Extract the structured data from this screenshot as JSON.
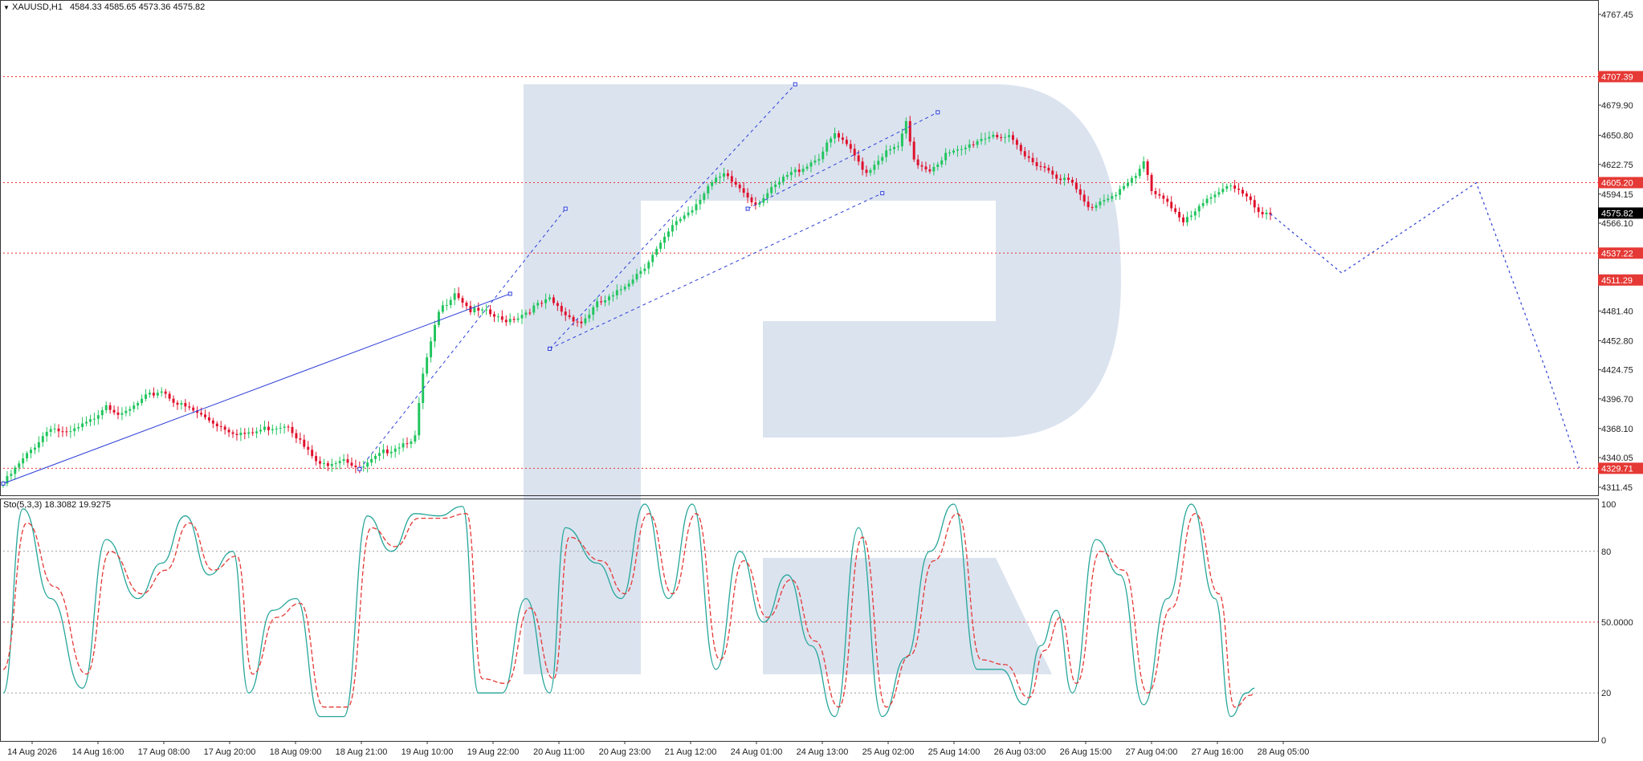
{
  "main_chart": {
    "symbol_header": "XAUUSD,H1",
    "ohlc": "4584.33 4585.65 4573.36 4575.82",
    "chart_data": {
      "type": "candlestick",
      "symbol": "XAUUSD",
      "timeframe": "H1",
      "ylim": [
        4306.0,
        4772.0
      ],
      "y_ticks": [
        "4767.45",
        "4679.90",
        "4650.80",
        "4622.75",
        "4594.15",
        "4566.10",
        "4481.40",
        "4452.80",
        "4424.75",
        "4396.70",
        "4368.10",
        "4340.05",
        "4311.45"
      ],
      "x_ticks": [
        "14 Aug 2026",
        "14 Aug 16:00",
        "17 Aug 08:00",
        "17 Aug 20:00",
        "18 Aug 09:00",
        "18 Aug 21:00",
        "19 Aug 10:00",
        "19 Aug 22:00",
        "20 Aug 11:00",
        "20 Aug 23:00",
        "21 Aug 12:00",
        "24 Aug 01:00",
        "24 Aug 13:00",
        "25 Aug 02:00",
        "25 Aug 14:00",
        "26 Aug 03:00",
        "26 Aug 15:00",
        "27 Aug 04:00",
        "27 Aug 16:00",
        "28 Aug 05:00"
      ],
      "levels": [
        {
          "value": 4707.39,
          "label": "4707.39"
        },
        {
          "value": 4605.2,
          "label": "4605.20"
        },
        {
          "value": 4537.22,
          "label": "4537.22"
        },
        {
          "value": 4329.71,
          "label": "4329.71"
        }
      ],
      "right_tags": [
        {
          "value": 4707.39,
          "label": "4707.39",
          "color": "#e53935"
        },
        {
          "value": 4605.2,
          "label": "4605.20",
          "color": "#e53935"
        },
        {
          "value": 4575.82,
          "label": "4575.82",
          "color": "#000000"
        },
        {
          "value": 4537.22,
          "label": "4537.22",
          "color": "#e53935"
        },
        {
          "value": 4511.29,
          "label": "4511.29",
          "color": "#e53935"
        },
        {
          "value": 4329.71,
          "label": "4329.71",
          "color": "#e53935"
        }
      ],
      "anchors": [
        [
          0,
          4315
        ],
        [
          12,
          4370
        ],
        [
          16,
          4362
        ],
        [
          22,
          4375
        ],
        [
          26,
          4392
        ],
        [
          30,
          4380
        ],
        [
          36,
          4398
        ],
        [
          40,
          4405
        ],
        [
          44,
          4392
        ],
        [
          48,
          4385
        ],
        [
          54,
          4372
        ],
        [
          58,
          4365
        ],
        [
          62,
          4362
        ],
        [
          66,
          4368
        ],
        [
          72,
          4372
        ],
        [
          76,
          4350
        ],
        [
          80,
          4332
        ],
        [
          86,
          4340
        ],
        [
          90,
          4328
        ],
        [
          96,
          4345
        ],
        [
          100,
          4352
        ],
        [
          104,
          4360
        ],
        [
          106,
          4420
        ],
        [
          110,
          4480
        ],
        [
          114,
          4500
        ],
        [
          118,
          4482
        ],
        [
          122,
          4480
        ],
        [
          126,
          4472
        ],
        [
          130,
          4476
        ],
        [
          134,
          4485
        ],
        [
          138,
          4492
        ],
        [
          142,
          4478
        ],
        [
          146,
          4470
        ],
        [
          150,
          4488
        ],
        [
          154,
          4495
        ],
        [
          158,
          4510
        ],
        [
          162,
          4525
        ],
        [
          166,
          4545
        ],
        [
          170,
          4568
        ],
        [
          174,
          4580
        ],
        [
          178,
          4602
        ],
        [
          182,
          4612
        ],
        [
          186,
          4600
        ],
        [
          190,
          4585
        ],
        [
          194,
          4598
        ],
        [
          198,
          4612
        ],
        [
          202,
          4620
        ],
        [
          206,
          4630
        ],
        [
          210,
          4652
        ],
        [
          214,
          4636
        ],
        [
          218,
          4615
        ],
        [
          222,
          4632
        ],
        [
          226,
          4640
        ],
        [
          228,
          4662
        ],
        [
          230,
          4625
        ],
        [
          234,
          4618
        ],
        [
          238,
          4632
        ],
        [
          242,
          4636
        ],
        [
          246,
          4646
        ],
        [
          250,
          4652
        ],
        [
          254,
          4648
        ],
        [
          258,
          4630
        ],
        [
          262,
          4622
        ],
        [
          266,
          4612
        ],
        [
          270,
          4604
        ],
        [
          274,
          4580
        ],
        [
          278,
          4590
        ],
        [
          282,
          4598
        ],
        [
          286,
          4610
        ],
        [
          288,
          4625
        ],
        [
          290,
          4598
        ],
        [
          294,
          4588
        ],
        [
          298,
          4566
        ],
        [
          302,
          4580
        ],
        [
          306,
          4596
        ],
        [
          310,
          4604
        ],
        [
          314,
          4590
        ],
        [
          318,
          4572
        ],
        [
          320,
          4575
        ]
      ],
      "pattern_lines": [
        {
          "points": [
            [
              0,
              4315
            ],
            [
              128,
              4498
            ]
          ],
          "style": "solid"
        },
        [
          [
            90,
            4329
          ],
          [
            142,
            4580
          ]
        ],
        [
          [
            138,
            4445
          ],
          [
            222,
            4595
          ]
        ],
        [
          [
            138,
            4445
          ],
          [
            200,
            4700
          ]
        ],
        [
          [
            188,
            4580
          ],
          [
            236,
            4673
          ]
        ]
      ],
      "forecast": [
        [
          320,
          4575
        ],
        [
          338,
          4518
        ],
        [
          372,
          4605
        ],
        [
          390,
          4420
        ],
        [
          398,
          4330
        ]
      ]
    }
  },
  "indicator": {
    "label": "Sto(5,3,3) 18.3082 19.9275",
    "chart_data": {
      "type": "line",
      "ylim": [
        0,
        100
      ],
      "y_ticks": [
        "100",
        "80",
        "50.0000",
        "20",
        "0"
      ],
      "levels": [
        80,
        50,
        20
      ],
      "series": [
        {
          "name": "Main",
          "color": "#26a69a",
          "style": "solid"
        },
        {
          "name": "Signal",
          "color": "#e53935",
          "style": "dashed"
        }
      ],
      "main_anchors": [
        [
          0,
          20
        ],
        [
          5,
          98
        ],
        [
          12,
          60
        ],
        [
          20,
          22
        ],
        [
          26,
          85
        ],
        [
          34,
          60
        ],
        [
          40,
          75
        ],
        [
          46,
          95
        ],
        [
          52,
          70
        ],
        [
          58,
          80
        ],
        [
          62,
          20
        ],
        [
          68,
          55
        ],
        [
          74,
          60
        ],
        [
          80,
          10
        ],
        [
          86,
          10
        ],
        [
          92,
          95
        ],
        [
          98,
          80
        ],
        [
          104,
          96
        ],
        [
          110,
          95
        ],
        [
          116,
          99
        ],
        [
          120,
          20
        ],
        [
          126,
          20
        ],
        [
          132,
          60
        ],
        [
          138,
          20
        ],
        [
          142,
          90
        ],
        [
          150,
          75
        ],
        [
          156,
          60
        ],
        [
          162,
          100
        ],
        [
          168,
          60
        ],
        [
          174,
          100
        ],
        [
          180,
          30
        ],
        [
          186,
          80
        ],
        [
          192,
          50
        ],
        [
          198,
          70
        ],
        [
          204,
          40
        ],
        [
          210,
          10
        ],
        [
          216,
          90
        ],
        [
          222,
          10
        ],
        [
          228,
          35
        ],
        [
          234,
          80
        ],
        [
          240,
          100
        ],
        [
          246,
          30
        ],
        [
          252,
          30
        ],
        [
          258,
          15
        ],
        [
          262,
          40
        ],
        [
          266,
          55
        ],
        [
          270,
          20
        ],
        [
          276,
          85
        ],
        [
          282,
          70
        ],
        [
          288,
          15
        ],
        [
          294,
          60
        ],
        [
          300,
          100
        ],
        [
          306,
          60
        ],
        [
          310,
          10
        ],
        [
          314,
          20
        ],
        [
          316,
          22
        ]
      ],
      "signal_anchors": [
        [
          0,
          30
        ],
        [
          6,
          92
        ],
        [
          13,
          65
        ],
        [
          21,
          28
        ],
        [
          27,
          80
        ],
        [
          35,
          62
        ],
        [
          41,
          72
        ],
        [
          47,
          92
        ],
        [
          53,
          72
        ],
        [
          59,
          78
        ],
        [
          63,
          28
        ],
        [
          69,
          52
        ],
        [
          75,
          58
        ],
        [
          81,
          14
        ],
        [
          87,
          14
        ],
        [
          93,
          90
        ],
        [
          99,
          82
        ],
        [
          105,
          94
        ],
        [
          111,
          94
        ],
        [
          117,
          96
        ],
        [
          121,
          26
        ],
        [
          127,
          24
        ],
        [
          133,
          56
        ],
        [
          139,
          26
        ],
        [
          143,
          86
        ],
        [
          151,
          76
        ],
        [
          157,
          62
        ],
        [
          163,
          96
        ],
        [
          169,
          62
        ],
        [
          175,
          96
        ],
        [
          181,
          34
        ],
        [
          187,
          76
        ],
        [
          193,
          52
        ],
        [
          199,
          68
        ],
        [
          205,
          42
        ],
        [
          211,
          14
        ],
        [
          217,
          86
        ],
        [
          223,
          14
        ],
        [
          229,
          36
        ],
        [
          235,
          76
        ],
        [
          241,
          96
        ],
        [
          247,
          34
        ],
        [
          253,
          32
        ],
        [
          259,
          18
        ],
        [
          263,
          38
        ],
        [
          267,
          52
        ],
        [
          271,
          24
        ],
        [
          277,
          80
        ],
        [
          283,
          72
        ],
        [
          289,
          20
        ],
        [
          295,
          56
        ],
        [
          301,
          96
        ],
        [
          307,
          62
        ],
        [
          311,
          14
        ],
        [
          315,
          19
        ],
        [
          316,
          20
        ]
      ]
    }
  },
  "time_axis": {
    "labels": [
      "14 Aug 2026",
      "14 Aug 16:00",
      "17 Aug 08:00",
      "17 Aug 20:00",
      "18 Aug 09:00",
      "18 Aug 21:00",
      "19 Aug 10:00",
      "19 Aug 22:00",
      "20 Aug 11:00",
      "20 Aug 23:00",
      "21 Aug 12:00",
      "24 Aug 01:00",
      "24 Aug 13:00",
      "25 Aug 02:00",
      "25 Aug 14:00",
      "26 Aug 03:00",
      "26 Aug 15:00",
      "27 Aug 04:00",
      "27 Aug 16:00",
      "28 Aug 05:00"
    ]
  },
  "colors": {
    "bull": "#22c55e",
    "bear": "#e0102c",
    "pattern": "#2b3ed8",
    "level": "#e53935",
    "watermark": "#d5deec",
    "panel_border": "#333333"
  }
}
